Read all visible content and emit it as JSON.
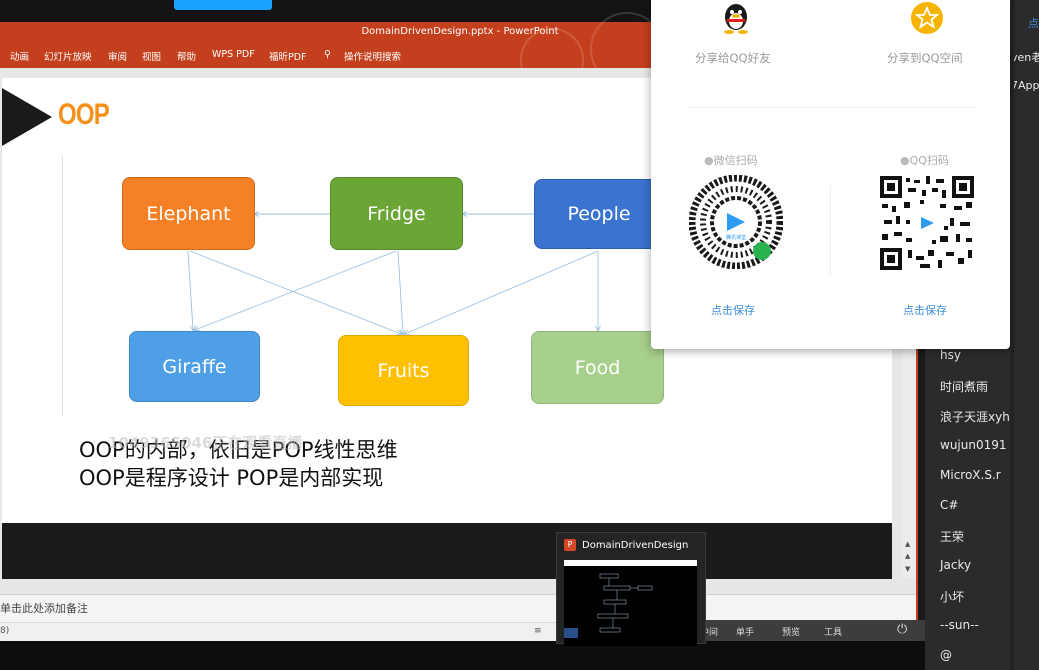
{
  "ppt": {
    "window_title": "DomainDrivenDesign.pptx  -  PowerPoint",
    "ribbon_tabs": [
      "动画",
      "幻灯片放映",
      "审阅",
      "视图",
      "帮助",
      "WPS PDF",
      "福昕PDF",
      "操作说明搜索"
    ],
    "notes_placeholder": "单击此处添加备注",
    "status_left": "8)",
    "taskbar_labels": [
      "中间",
      "单手",
      "预览",
      "工具"
    ]
  },
  "slide": {
    "title": "OOP",
    "nodes": [
      {
        "id": "elephant",
        "label": "Elephant",
        "color": "#f58025"
      },
      {
        "id": "fridge",
        "label": "Fridge",
        "color": "#6aa535"
      },
      {
        "id": "people",
        "label": "People",
        "color": "#3b73d1"
      },
      {
        "id": "giraffe",
        "label": "Giraffe",
        "color": "#4e9fe6"
      },
      {
        "id": "fruits",
        "label": "Fruits",
        "color": "#ffc000"
      },
      {
        "id": "food",
        "label": "Food",
        "color": "#a8d08d"
      }
    ],
    "edges": [
      {
        "from": "fridge",
        "to": "elephant"
      },
      {
        "from": "people",
        "to": "fridge"
      },
      {
        "from": "elephant",
        "to": "giraffe"
      },
      {
        "from": "elephant",
        "to": "fruits"
      },
      {
        "from": "fridge",
        "to": "giraffe"
      },
      {
        "from": "fridge",
        "to": "fruits"
      },
      {
        "from": "people",
        "to": "fruits"
      },
      {
        "from": "people",
        "to": "food"
      }
    ],
    "line1": "OOP的内部，依旧是POP线性思维",
    "line2": "OOP是程序设计  POP是内部实现",
    "watermark": "1049365046正在观看直播"
  },
  "share": {
    "qq_friend": "分享给QQ好友",
    "qq_zone": "分享到QQ空间",
    "wechat_scan": "微信扫码",
    "qq_scan": "QQ扫码",
    "save_wechat": "点击保存",
    "save_qq": "点击保存",
    "qr_center_text": "腾讯课堂"
  },
  "chat": {
    "names": [
      "hsy",
      "时间煮雨",
      "浪子天涯xyh",
      "wujun0191",
      "MicroX.S.r",
      "C#",
      "王荣",
      "Jacky",
      "小坏",
      "--sun--",
      "@"
    ],
    "fragments": [
      "点",
      "ven老",
      "7App"
    ]
  },
  "thumbnail": {
    "title": "DomainDrivenDesign"
  }
}
